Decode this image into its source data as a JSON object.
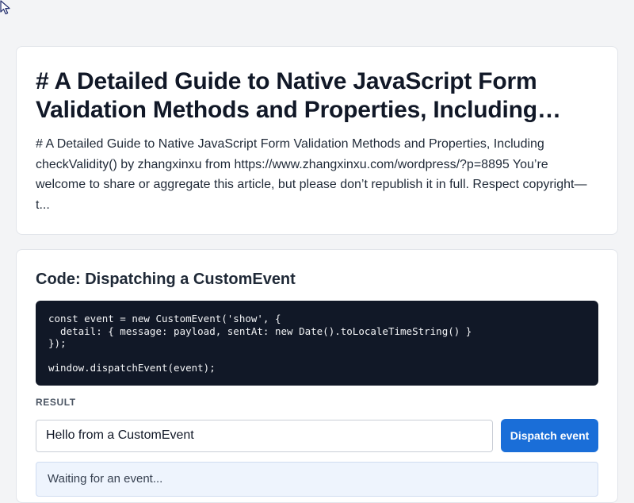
{
  "article": {
    "title": "# A Detailed Guide to Native JavaScript Form Validation Methods and Properties, Including checkValidity()",
    "excerpt": "# A Detailed Guide to Native JavaScript Form Validation Methods and Properties, Including checkValidity() by zhangxinxu from https://www.zhangxinxu.com/wordpress/?p=8895 You’re welcome to share or aggregate this article, but please don’t republish it in full. Respect copyright—t..."
  },
  "code_section": {
    "title": "Code: Dispatching a CustomEvent",
    "code": "const event = new CustomEvent('show', {\n  detail: { message: payload, sentAt: new Date().toLocaleTimeString() }\n});\n\nwindow.dispatchEvent(event);",
    "result_label": "RESULT",
    "input_value": "Hello from a CustomEvent",
    "button_label": "Dispatch event",
    "output_text": "Waiting for an event..."
  },
  "icons": {
    "cursor": "mouse-pointer-icon"
  },
  "colors": {
    "accent": "#1a6ed8",
    "code_bg": "#111827",
    "page_bg": "#f3f4f6"
  }
}
